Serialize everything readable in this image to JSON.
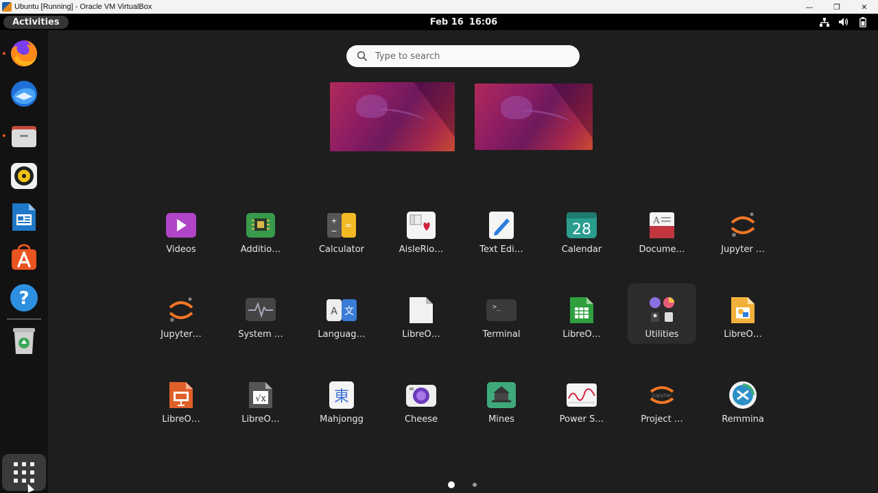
{
  "window": {
    "title": "Ubuntu [Running] - Oracle VM VirtualBox",
    "controls": {
      "minimize": "—",
      "restore": "❐",
      "close": "✕"
    }
  },
  "topbar": {
    "activities": "Activities",
    "date": "Feb 16",
    "time": "16:06",
    "tray": [
      "network-icon",
      "volume-icon",
      "battery-icon"
    ]
  },
  "dock": {
    "items": [
      {
        "name": "firefox-icon",
        "running": true
      },
      {
        "name": "thunderbird-icon",
        "running": false
      },
      {
        "name": "files-icon",
        "running": true
      },
      {
        "name": "rhythmbox-icon",
        "running": false
      },
      {
        "name": "libreoffice-writer-icon",
        "running": false
      },
      {
        "name": "ubuntu-software-icon",
        "running": false
      },
      {
        "name": "help-icon",
        "running": false
      },
      {
        "name": "trash-icon",
        "running": false
      }
    ],
    "show_apps": "show-applications-icon"
  },
  "search": {
    "placeholder": "Type to search"
  },
  "workspaces": 2,
  "apps": [
    [
      {
        "label": "Videos",
        "icon": "videos-icon"
      },
      {
        "label": "Additio…",
        "icon": "additional-drivers-icon"
      },
      {
        "label": "Calculator",
        "icon": "calculator-icon"
      },
      {
        "label": "AisleRio…",
        "icon": "aisleriot-icon"
      },
      {
        "label": "Text Edi…",
        "icon": "text-editor-icon"
      },
      {
        "label": "Calendar",
        "icon": "calendar-icon",
        "text": "28"
      },
      {
        "label": "Docume…",
        "icon": "document-viewer-icon"
      },
      {
        "label": "Jupyter …",
        "icon": "jupyter-icon"
      }
    ],
    [
      {
        "label": "Jupyter…",
        "icon": "jupyter-icon"
      },
      {
        "label": "System …",
        "icon": "system-monitor-icon"
      },
      {
        "label": "Languag…",
        "icon": "language-support-icon"
      },
      {
        "label": "LibreO…",
        "icon": "libreoffice-icon"
      },
      {
        "label": "Terminal",
        "icon": "terminal-icon"
      },
      {
        "label": "LibreO…",
        "icon": "libreoffice-calc-icon"
      },
      {
        "label": "Utilities",
        "icon": "utilities-folder-icon",
        "hover": true
      },
      {
        "label": "LibreO…",
        "icon": "libreoffice-draw-icon"
      }
    ],
    [
      {
        "label": "LibreO…",
        "icon": "libreoffice-impress-icon"
      },
      {
        "label": "LibreO…",
        "icon": "libreoffice-math-icon"
      },
      {
        "label": "Mahjongg",
        "icon": "mahjongg-icon",
        "text": "東"
      },
      {
        "label": "Cheese",
        "icon": "cheese-icon"
      },
      {
        "label": "Mines",
        "icon": "mines-icon"
      },
      {
        "label": "Power S…",
        "icon": "power-statistics-icon"
      },
      {
        "label": "Project …",
        "icon": "project-jupyter-icon"
      },
      {
        "label": "Remmina",
        "icon": "remmina-icon"
      }
    ]
  ],
  "pagination": {
    "pages": 2,
    "current": 1
  },
  "colors": {
    "accent": "#e95420",
    "panel": "#000000",
    "background": "#1e1e1e"
  }
}
